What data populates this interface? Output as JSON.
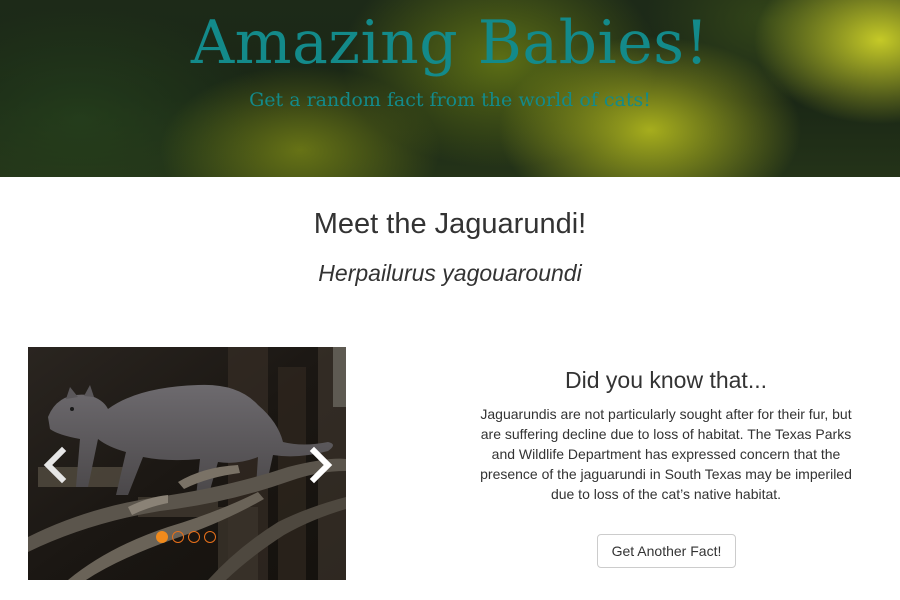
{
  "hero": {
    "title": "Amazing Babies!",
    "subtitle": "Get a random fact from the world of cats!"
  },
  "cat": {
    "heading": "Meet the Jaguarundi!",
    "scientific_name": "Herpailurus yagouaroundi"
  },
  "carousel": {
    "slide_count": 4,
    "active_index": 0,
    "prev_icon": "chevron-left-icon",
    "next_icon": "chevron-right-icon"
  },
  "fact": {
    "heading": "Did you know that...",
    "text": "Jaguarundis are not particularly sought after for their fur, but are suffering decline due to loss of habitat. The Texas Parks and Wildlife Department has expressed concern that the presence of the jaguarundi in South Texas may be imperiled due to loss of the cat’s native habitat.",
    "button_label": "Get Another Fact!"
  },
  "colors": {
    "title_teal": "#138a8a",
    "indicator_orange": "#f08a1c",
    "text": "#333333"
  }
}
